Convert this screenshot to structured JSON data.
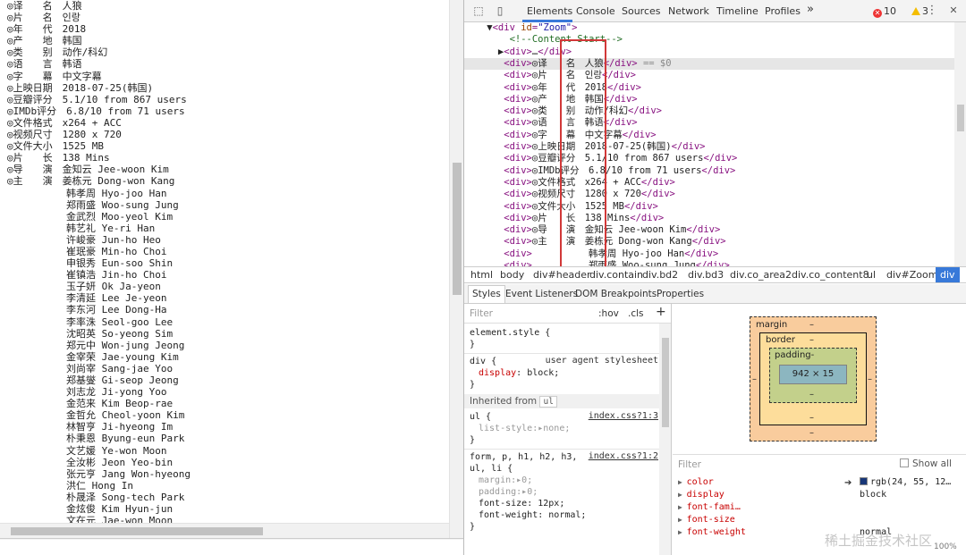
{
  "left_page": {
    "lines": [
      "◎译　　名　人狼",
      "◎片　　名　인랑",
      "◎年　　代　2018",
      "◎产　　地　韩国",
      "◎类　　别　动作/科幻",
      "◎语　　言　韩语",
      "◎字　　幕　中文字幕",
      "◎上映日期　2018-07-25(韩国)",
      "◎豆瓣评分　5.1/10 from 867 users",
      "◎IMDb评分　6.8/10 from 71 users",
      "◎文件格式　x264 + ACC",
      "◎视频尺寸　1280 x 720",
      "◎文件大小　1525 MB",
      "◎片　　长　138 Mins",
      "◎导　　演　金知云 Jee-woon Kim",
      "◎主　　演　姜栋元 Dong-won Kang",
      "　　　　　　韩孝周 Hyo-joo Han",
      "　　　　　　郑雨盛 Woo-sung Jung",
      "　　　　　　金武烈 Moo-yeol Kim",
      "　　　　　　韩艺礼 Ye-ri Han",
      "　　　　　　许峻豪 Jun-ho Heo",
      "　　　　　　崔珉豪 Min-ho Choi",
      "　　　　　　申银秀 Eun-soo Shin",
      "　　　　　　崔镇浩 Jin-ho Choi",
      "　　　　　　玉子妍 Ok Ja-yeon",
      "　　　　　　李清延 Lee Je-yeon",
      "　　　　　　李东河 Lee Dong-Ha",
      "　　　　　　李率洙 Seol-goo Lee",
      "　　　　　　沈昭英 So-yeong Sim",
      "　　　　　　郑元中 Won-jung Jeong",
      "　　　　　　金宰荣 Jae-young Kim",
      "　　　　　　刘尚宰 Sang-jae Yoo",
      "　　　　　　郑基燮 Gi-seop Jeong",
      "　　　　　　刘志龙 Ji-yong Yoo",
      "　　　　　　金范来 Kim Beop-rae",
      "　　　　　　金哲允 Cheol-yoon Kim",
      "　　　　　　林智亨 Ji-hyeong Im",
      "　　　　　　朴秉恩 Byung-eun Park",
      "　　　　　　文艺媛 Ye-won Moon",
      "　　　　　　全汝彬 Jeon Yeo-bin",
      "　　　　　　张元亨 Jang Won-hyeong",
      "　　　　　　洪仁 Hong In",
      "　　　　　　朴晟泽 Song-tech Park",
      "　　　　　　金炫俊 Kim Hyun-jun",
      "　　　　　　文在元 Jae-won Moon"
    ],
    "drawer_icon": "≡"
  },
  "devtools": {
    "tabs": [
      "Elements",
      "Console",
      "Sources",
      "Network",
      "Timeline",
      "Profiles"
    ],
    "more_tabs": "»",
    "errors": "10",
    "warnings": "3",
    "menu": "⋮",
    "close": "✕",
    "inspect_icon": "⬚",
    "device_icon": "▯",
    "dom_lines": [
      {
        "pre": "    ▼",
        "open": "<div ",
        "attr": "id",
        "val": "\"Zoom\"",
        "close": ">",
        "text": "",
        "end": ""
      },
      {
        "pre": "        ",
        "comment": "<!--Content Start-->"
      },
      {
        "pre": "      ▶",
        "open": "<div>",
        "text": "…",
        "end": "</div>"
      },
      {
        "pre": "       ",
        "open": "<div>",
        "text": "◎译　　名　人狼",
        "end": "</div>",
        "eq": " == $0"
      },
      {
        "pre": "       ",
        "open": "<div>",
        "text": "◎片　　名　인랑",
        "end": "</div>"
      },
      {
        "pre": "       ",
        "open": "<div>",
        "text": "◎年　　代　2018",
        "end": "</div>"
      },
      {
        "pre": "       ",
        "open": "<div>",
        "text": "◎产　　地　韩国",
        "end": "</div>"
      },
      {
        "pre": "       ",
        "open": "<div>",
        "text": "◎类　　别　动作/科幻",
        "end": "</div>"
      },
      {
        "pre": "       ",
        "open": "<div>",
        "text": "◎语　　言　韩语",
        "end": "</div>"
      },
      {
        "pre": "       ",
        "open": "<div>",
        "text": "◎字　　幕　中文字幕",
        "end": "</div>"
      },
      {
        "pre": "       ",
        "open": "<div>",
        "text": "◎上映日期　2018-07-25(韩国)",
        "end": "</div>"
      },
      {
        "pre": "       ",
        "open": "<div>",
        "text": "◎豆瓣评分　5.1/10 from 867 users",
        "end": "</div>"
      },
      {
        "pre": "       ",
        "open": "<div>",
        "text": "◎IMDb评分　6.8/10 from 71 users",
        "end": "</div>"
      },
      {
        "pre": "       ",
        "open": "<div>",
        "text": "◎文件格式　x264 + ACC",
        "end": "</div>"
      },
      {
        "pre": "       ",
        "open": "<div>",
        "text": "◎视频尺寸　1280 x 720",
        "end": "</div>"
      },
      {
        "pre": "       ",
        "open": "<div>",
        "text": "◎文件大小　1525 MB",
        "end": "</div>"
      },
      {
        "pre": "       ",
        "open": "<div>",
        "text": "◎片　　长　138 Mins",
        "end": "</div>"
      },
      {
        "pre": "       ",
        "open": "<div>",
        "text": "◎导　　演　金知云 Jee-woon Kim",
        "end": "</div>"
      },
      {
        "pre": "       ",
        "open": "<div>",
        "text": "◎主　　演　姜栋元 Dong-won Kang",
        "end": "</div>"
      },
      {
        "pre": "       ",
        "open": "<div>",
        "text": "　　　　　　韩孝周 Hyo-joo Han",
        "end": "</div>"
      },
      {
        "pre": "       ",
        "open": "<div>",
        "text": "　　　　　　郑雨盛 Woo-sung Jung",
        "end": "</div>"
      }
    ],
    "dom_gutter": "...",
    "breadcrumb": [
      "html",
      "body",
      "div#header",
      "div.contain",
      "div.bd2",
      "div.bd3",
      "div.co_area2",
      "div.co_content8",
      "ul",
      "div#Zoom",
      "div"
    ],
    "sub_tabs": [
      "Styles",
      "Event Listeners",
      "DOM Breakpoints",
      "Properties"
    ],
    "styles": {
      "filter_placeholder": "Filter",
      "hov": ":hov",
      "cls": ".cls",
      "add": "+",
      "element_style_open": "element.style {",
      "close_brace": "}",
      "ua_selector": "div {",
      "ua_source": "user agent stylesheet",
      "ua_prop": "display",
      "ua_val": "block;",
      "inherited_label": "Inherited from",
      "inherited_tag": "ul",
      "ul_selector": "ul {",
      "ul_source": "index.css?1:3",
      "ul_prop": "list-style",
      "ul_val": "none;",
      "form_selector": "form, p, h1, h2, h3,",
      "form_selector2": "ul, li {",
      "form_source": "index.css?1:2",
      "margin_prop": "margin",
      "margin_val": "0;",
      "padding_prop": "padding",
      "padding_val": "0;",
      "fs_prop": "font-size",
      "fs_val": "12px;",
      "fw_prop": "font-weight",
      "fw_val": "normal;"
    },
    "box_model": {
      "margin_label": "margin",
      "border_label": "border",
      "padding_label": "padding-",
      "content_size": "942 × 15",
      "dash": "–"
    },
    "computed": {
      "filter_placeholder": "Filter",
      "show_all": "Show all",
      "props": [
        {
          "name": "color",
          "value": "rgb(24, 55, 12…"
        },
        {
          "name": "display",
          "value": "block"
        },
        {
          "name": "font-fami…",
          "value": ""
        },
        {
          "name": "font-size",
          "value": ""
        },
        {
          "name": "font-weight",
          "value": "normal"
        }
      ]
    },
    "watermark": "稀土掘金技术社区",
    "zoom": "100%"
  }
}
